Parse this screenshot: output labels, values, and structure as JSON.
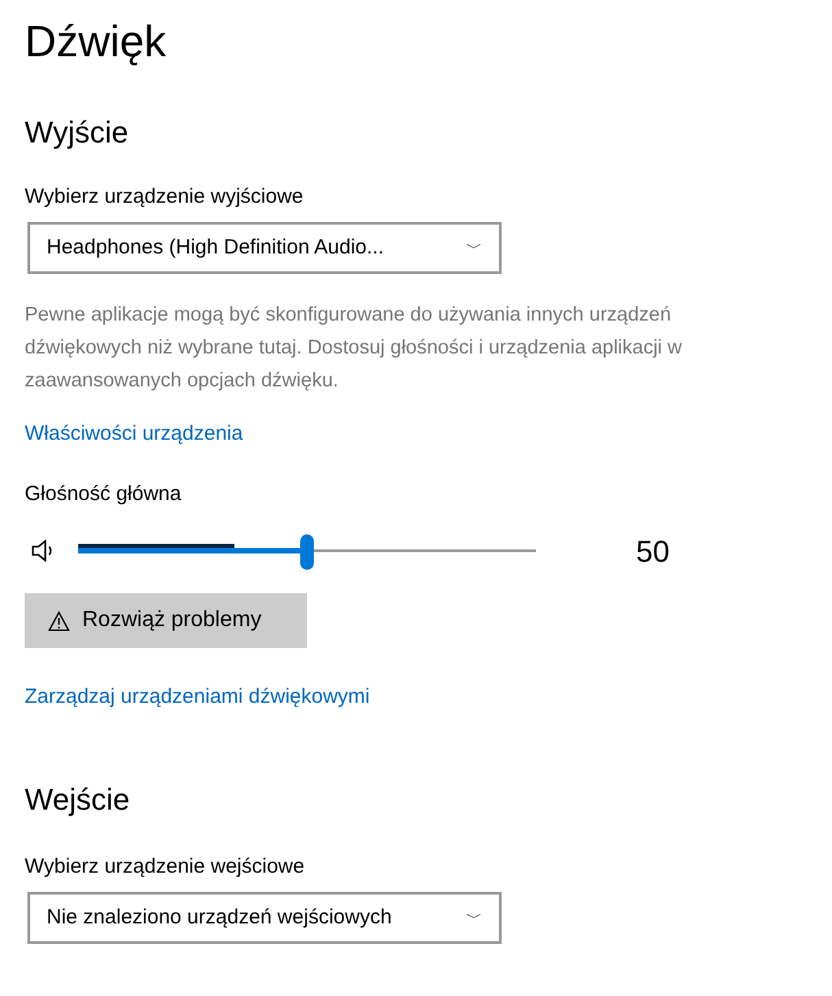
{
  "title": "Dźwięk",
  "output": {
    "heading": "Wyjście",
    "device_label": "Wybierz urządzenie wyjściowe",
    "device_value": "Headphones (High Definition Audio...",
    "dropdown_glyph": "﹀",
    "note": "Pewne aplikacje mogą być skonfigurowane do używania innych urządzeń dźwiękowych niż wybrane tutaj. Dostosuj głośności i urządzenia aplikacji w zaawansowanych opcjach dźwięku.",
    "properties_link": "Właściwości urządzenia",
    "volume_label": "Głośność główna",
    "volume": {
      "level": 0.5,
      "reading": "50"
    },
    "meter": {
      "level": 0.34
    },
    "troubleshoot_button": "Rozwiąż problemy",
    "manage_link": "Zarządzaj urządzeniami dźwiękowymi"
  },
  "input": {
    "heading": "Wejście",
    "device_label": "Wybierz urządzenie wejściowe",
    "device_value": "Nie znaleziono urządzeń wejściowych",
    "dropdown_glyph": "﹀"
  }
}
